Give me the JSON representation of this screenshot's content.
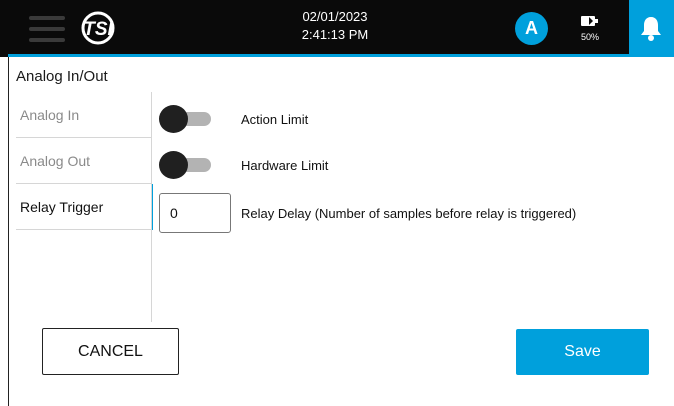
{
  "header": {
    "logo_text": "TSI",
    "date": "02/01/2023",
    "time": "2:41:13 PM",
    "avatar_initial": "A",
    "battery_level": "50%",
    "icons": [
      "menu-icon",
      "tsi-logo",
      "battery-icon",
      "bell-icon"
    ],
    "colors": {
      "accent": "#00a0dc",
      "bar": "#0a0a0a"
    }
  },
  "page": {
    "title": "Analog In/Out"
  },
  "sidebar": {
    "items": [
      {
        "label": "Analog In",
        "active": false
      },
      {
        "label": "Analog Out",
        "active": false
      },
      {
        "label": "Relay Trigger",
        "active": true
      }
    ]
  },
  "settings": {
    "action_limit": {
      "label": "Action Limit",
      "enabled": false
    },
    "hardware_limit": {
      "label": "Hardware Limit",
      "enabled": false
    },
    "relay_delay": {
      "label": "Relay Delay (Number of samples before relay is triggered)",
      "value": "0"
    }
  },
  "footer": {
    "cancel_label": "CANCEL",
    "save_label": "Save"
  }
}
